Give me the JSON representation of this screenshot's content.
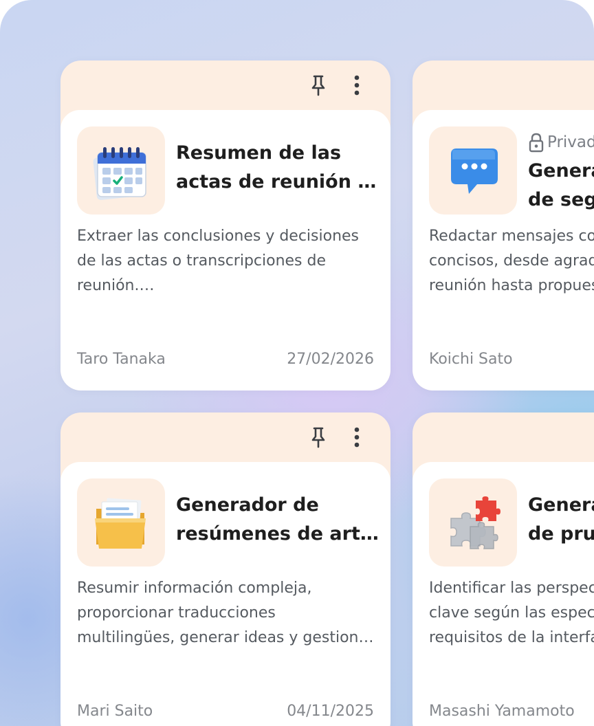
{
  "cards": [
    {
      "title_line1": "Resumen de las",
      "title_line2": "actas de reunión y…",
      "desc_line1": "Extraer las conclusiones y decisiones",
      "desc_line2": "de las actas o transcripciones de",
      "desc_line3": "reunión.…",
      "author": "Taro Tanaka",
      "date": "27/02/2026",
      "icon": "calendar-icon"
    },
    {
      "privacy_label": "Privado",
      "title_line1": "Generador de mensajes",
      "title_line2": "de seguimiento",
      "desc_line1": "Redactar mensajes corteses y",
      "desc_line2": "concisos, desde agradecimientos de",
      "desc_line3": "reunión hasta propuestas",
      "author": "Koichi Sato",
      "icon": "chat-bubble-icon"
    },
    {
      "title_line1": "Generador de",
      "title_line2": "resúmenes de artíc…",
      "desc_line1": "Resumir información compleja,",
      "desc_line2": "proporcionar traducciones",
      "desc_line3": "multilingües, generar ideas y gestion…",
      "author": "Mari Saito",
      "date": "04/11/2025",
      "icon": "folder-icon"
    },
    {
      "title_line1": "Generador de casos",
      "title_line2": "de prueba",
      "desc_line1": "Identificar las perspectivas de prueba",
      "desc_line2": "clave según las especificaciones y",
      "desc_line3": "requisitos de la interfaz",
      "author": "Masashi Yamamoto",
      "icon": "puzzle-icon"
    }
  ]
}
